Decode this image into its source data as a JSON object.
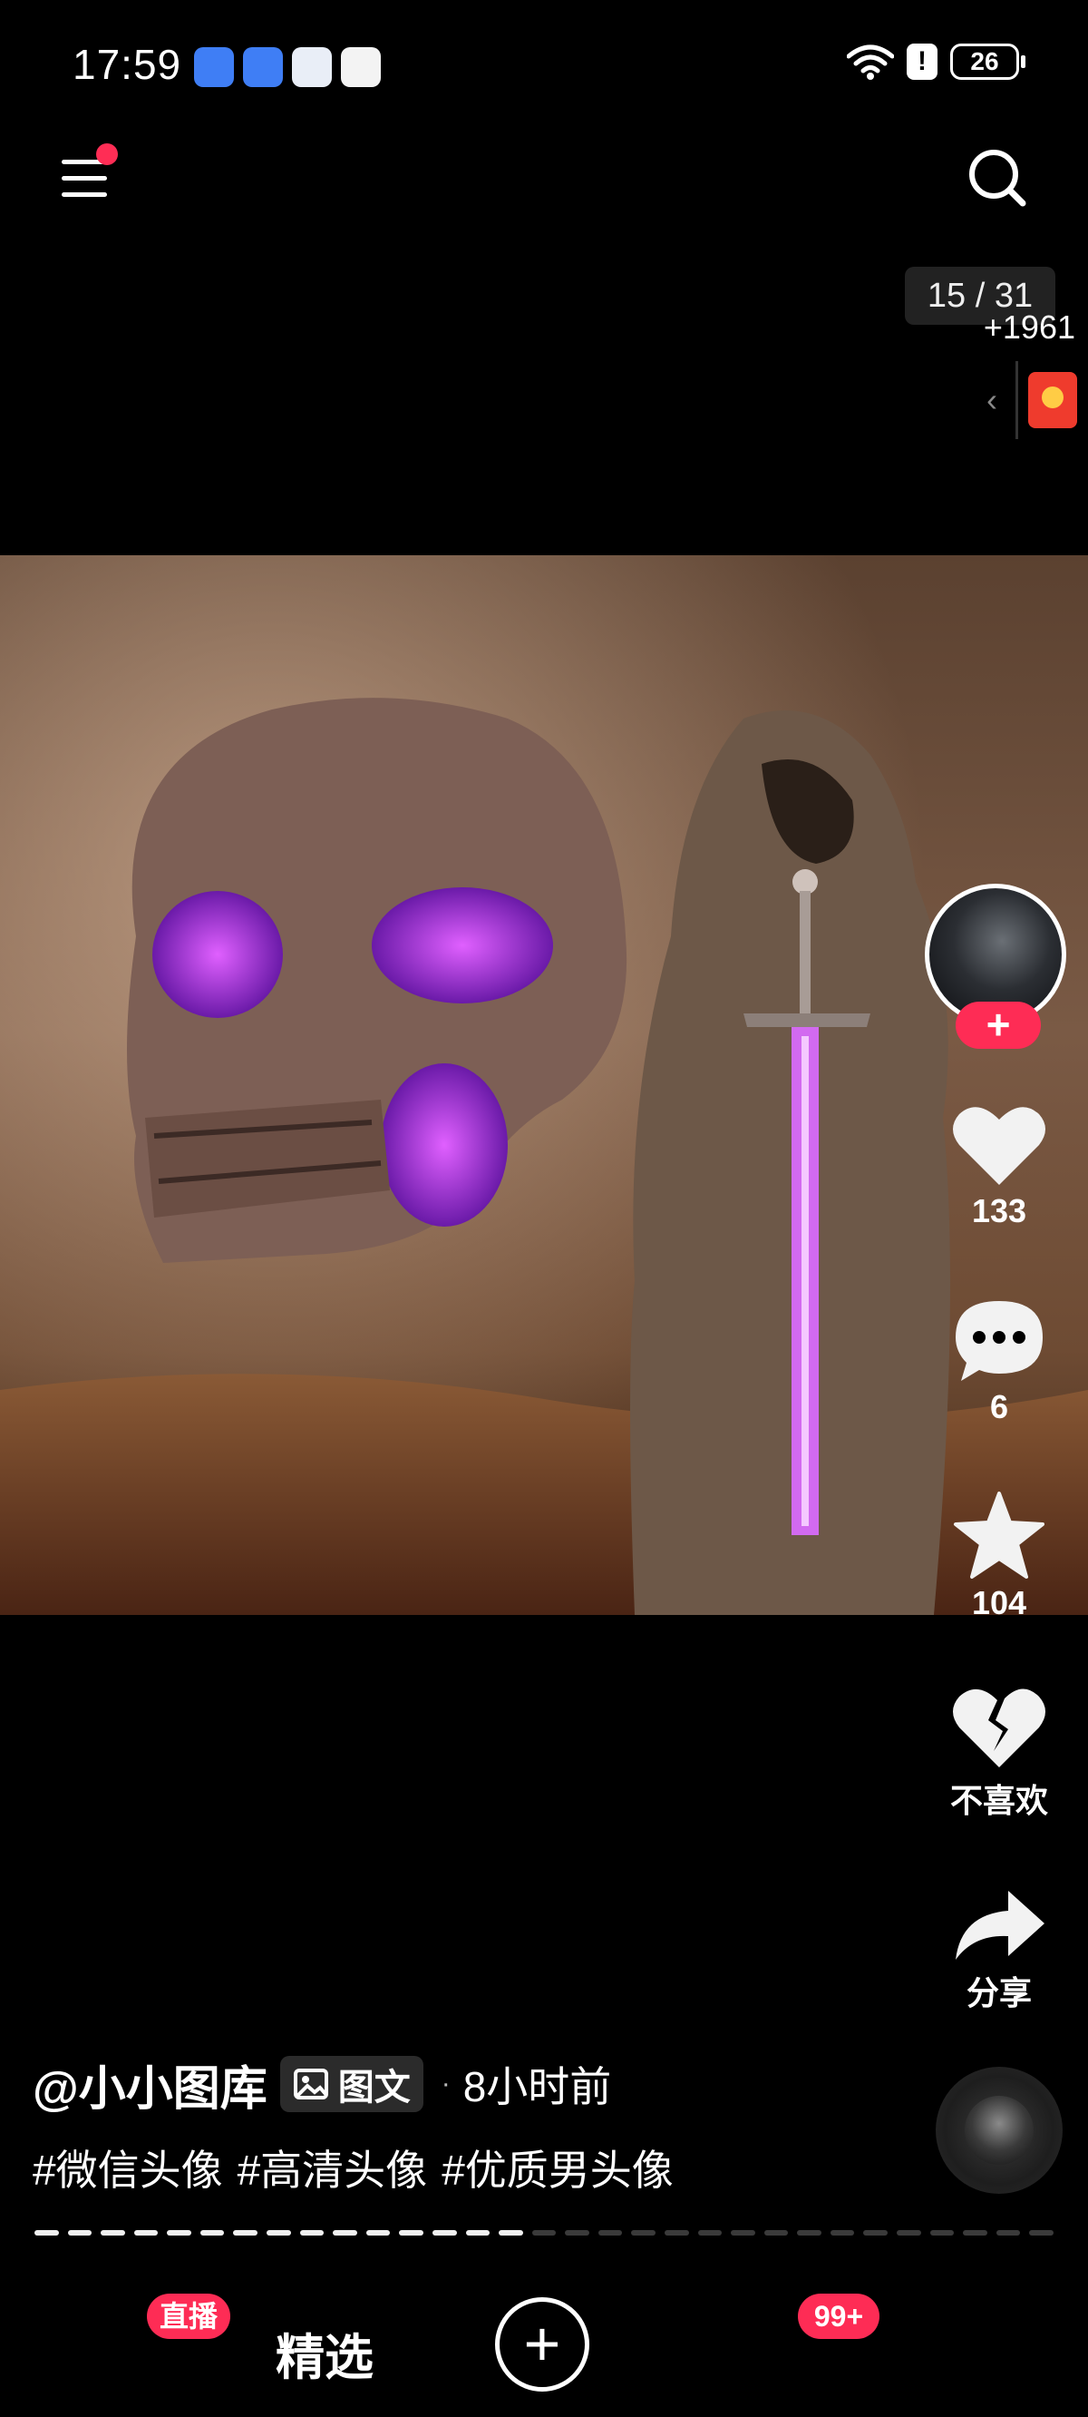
{
  "status_bar": {
    "time": "17:59",
    "battery": "26",
    "alert": "!"
  },
  "viewer": {
    "counter": "15 / 31",
    "reward_count": "+1961",
    "chevron": "‹"
  },
  "actions": {
    "follow": "+",
    "likes": "133",
    "comments": "6",
    "favorites": "104",
    "dislike_label": "不喜欢",
    "share_label": "分享"
  },
  "post": {
    "author": "@小小图库",
    "type_label": "图文",
    "separator": "·",
    "time_ago": "8小时前",
    "tags": [
      "#微信头像",
      "#高清头像",
      "#优质男头像"
    ],
    "progress_current": 15,
    "progress_total": 31
  },
  "bottom_nav": {
    "live_badge": "直播",
    "featured_label": "精选",
    "plus": "+",
    "message_badge": "99+"
  },
  "colors": {
    "accent": "#fe2c55",
    "background": "#000000"
  }
}
